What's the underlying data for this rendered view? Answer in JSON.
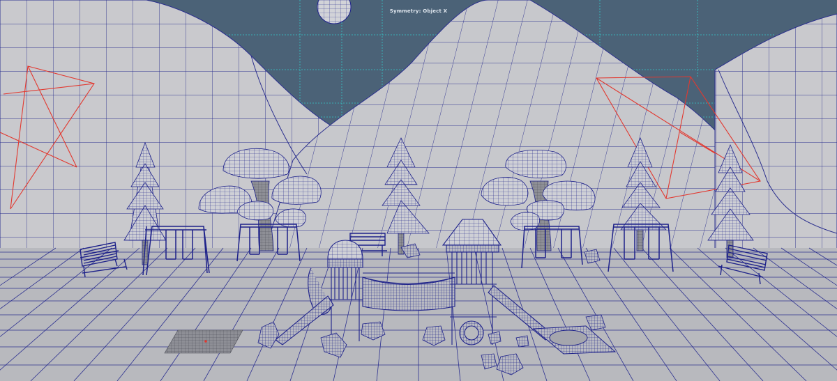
{
  "viewport": {
    "symmetry_label": "Symmetry: Object X",
    "colors": {
      "sky": "#4b6277",
      "terrain": "#c9c9cd",
      "ground": "#b8b9be",
      "wire": "#1b1f8a",
      "grid_cyan": "#35c9c9",
      "camera_red": "#e2382f"
    },
    "icons": [
      "symmetry-indicator"
    ]
  }
}
